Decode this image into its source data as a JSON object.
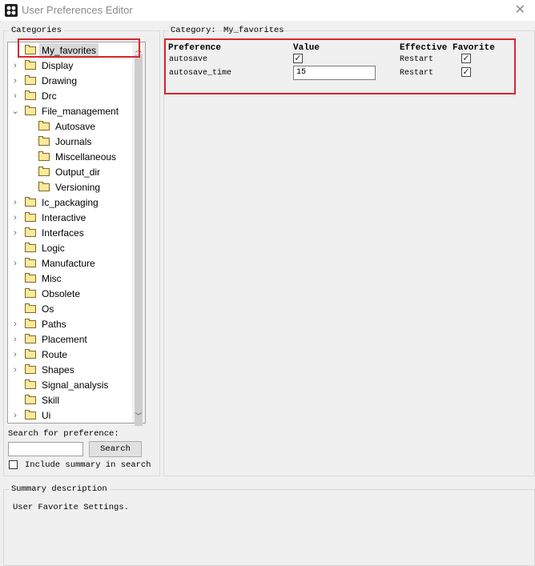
{
  "window": {
    "title": "User Preferences Editor",
    "close_glyph": "✕",
    "icon": "app-icon"
  },
  "categories": {
    "group_label": "Categories",
    "items": [
      {
        "label": "My_favorites",
        "expandable": false,
        "selected": true,
        "indent": 0
      },
      {
        "label": "Display",
        "expandable": true,
        "indent": 0
      },
      {
        "label": "Drawing",
        "expandable": true,
        "indent": 0
      },
      {
        "label": "Drc",
        "expandable": true,
        "indent": 0
      },
      {
        "label": "File_management",
        "expandable": true,
        "expanded": true,
        "indent": 0
      },
      {
        "label": "Autosave",
        "expandable": false,
        "indent": 1
      },
      {
        "label": "Journals",
        "expandable": false,
        "indent": 1
      },
      {
        "label": "Miscellaneous",
        "expandable": false,
        "indent": 1
      },
      {
        "label": "Output_dir",
        "expandable": false,
        "indent": 1
      },
      {
        "label": "Versioning",
        "expandable": false,
        "indent": 1
      },
      {
        "label": "Ic_packaging",
        "expandable": true,
        "indent": 0
      },
      {
        "label": "Interactive",
        "expandable": true,
        "indent": 0
      },
      {
        "label": "Interfaces",
        "expandable": true,
        "indent": 0
      },
      {
        "label": "Logic",
        "expandable": false,
        "indent": 0
      },
      {
        "label": "Manufacture",
        "expandable": true,
        "indent": 0
      },
      {
        "label": "Misc",
        "expandable": false,
        "indent": 0
      },
      {
        "label": "Obsolete",
        "expandable": false,
        "indent": 0
      },
      {
        "label": "Os",
        "expandable": false,
        "indent": 0
      },
      {
        "label": "Paths",
        "expandable": true,
        "indent": 0
      },
      {
        "label": "Placement",
        "expandable": true,
        "indent": 0
      },
      {
        "label": "Route",
        "expandable": true,
        "indent": 0
      },
      {
        "label": "Shapes",
        "expandable": true,
        "indent": 0
      },
      {
        "label": "Signal_analysis",
        "expandable": false,
        "indent": 0
      },
      {
        "label": "Skill",
        "expandable": false,
        "indent": 0
      },
      {
        "label": "Ui",
        "expandable": true,
        "indent": 0
      }
    ]
  },
  "search": {
    "label": "Search for preference:",
    "value": "",
    "button_label": "Search",
    "include_summary_label": "Include summary in search",
    "include_summary_checked": false
  },
  "detail": {
    "category_label": "Category:",
    "category_value": "My_favorites",
    "columns": {
      "preference": "Preference",
      "value": "Value",
      "effective": "Effective",
      "favorite": "Favorite"
    },
    "rows": [
      {
        "preference": "autosave",
        "value_type": "checkbox",
        "value_checked": true,
        "effective": "Restart",
        "favorite": true
      },
      {
        "preference": "autosave_time",
        "value_type": "text",
        "value": "15",
        "effective": "Restart",
        "favorite": true
      }
    ]
  },
  "summary": {
    "group_label": "Summary description",
    "text": "User Favorite Settings."
  },
  "colors": {
    "highlight": "#d9262c",
    "folder": "#ffe89a",
    "selection": "#d9d9d9"
  }
}
